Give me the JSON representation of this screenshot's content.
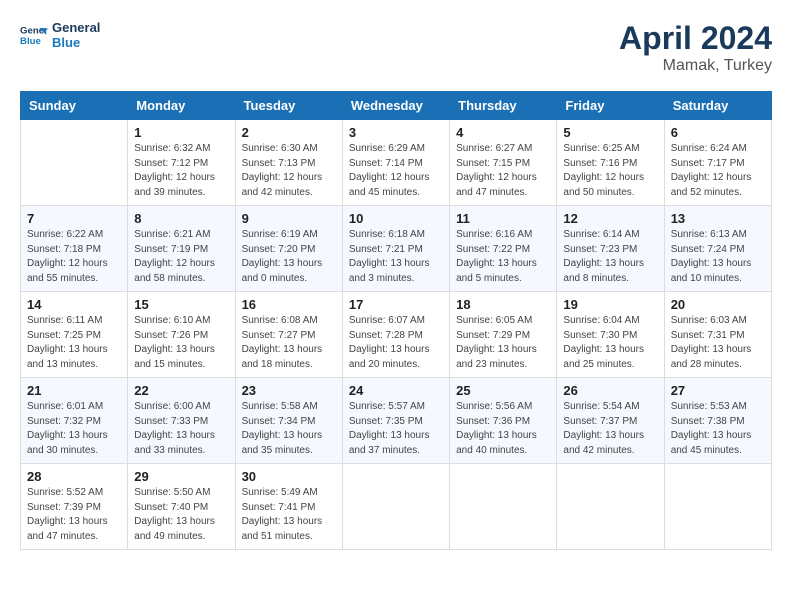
{
  "header": {
    "logo_line1": "General",
    "logo_line2": "Blue",
    "month_year": "April 2024",
    "location": "Mamak, Turkey"
  },
  "days_of_week": [
    "Sunday",
    "Monday",
    "Tuesday",
    "Wednesday",
    "Thursday",
    "Friday",
    "Saturday"
  ],
  "weeks": [
    [
      {
        "day": "",
        "info": ""
      },
      {
        "day": "1",
        "info": "Sunrise: 6:32 AM\nSunset: 7:12 PM\nDaylight: 12 hours\nand 39 minutes."
      },
      {
        "day": "2",
        "info": "Sunrise: 6:30 AM\nSunset: 7:13 PM\nDaylight: 12 hours\nand 42 minutes."
      },
      {
        "day": "3",
        "info": "Sunrise: 6:29 AM\nSunset: 7:14 PM\nDaylight: 12 hours\nand 45 minutes."
      },
      {
        "day": "4",
        "info": "Sunrise: 6:27 AM\nSunset: 7:15 PM\nDaylight: 12 hours\nand 47 minutes."
      },
      {
        "day": "5",
        "info": "Sunrise: 6:25 AM\nSunset: 7:16 PM\nDaylight: 12 hours\nand 50 minutes."
      },
      {
        "day": "6",
        "info": "Sunrise: 6:24 AM\nSunset: 7:17 PM\nDaylight: 12 hours\nand 52 minutes."
      }
    ],
    [
      {
        "day": "7",
        "info": "Sunrise: 6:22 AM\nSunset: 7:18 PM\nDaylight: 12 hours\nand 55 minutes."
      },
      {
        "day": "8",
        "info": "Sunrise: 6:21 AM\nSunset: 7:19 PM\nDaylight: 12 hours\nand 58 minutes."
      },
      {
        "day": "9",
        "info": "Sunrise: 6:19 AM\nSunset: 7:20 PM\nDaylight: 13 hours\nand 0 minutes."
      },
      {
        "day": "10",
        "info": "Sunrise: 6:18 AM\nSunset: 7:21 PM\nDaylight: 13 hours\nand 3 minutes."
      },
      {
        "day": "11",
        "info": "Sunrise: 6:16 AM\nSunset: 7:22 PM\nDaylight: 13 hours\nand 5 minutes."
      },
      {
        "day": "12",
        "info": "Sunrise: 6:14 AM\nSunset: 7:23 PM\nDaylight: 13 hours\nand 8 minutes."
      },
      {
        "day": "13",
        "info": "Sunrise: 6:13 AM\nSunset: 7:24 PM\nDaylight: 13 hours\nand 10 minutes."
      }
    ],
    [
      {
        "day": "14",
        "info": "Sunrise: 6:11 AM\nSunset: 7:25 PM\nDaylight: 13 hours\nand 13 minutes."
      },
      {
        "day": "15",
        "info": "Sunrise: 6:10 AM\nSunset: 7:26 PM\nDaylight: 13 hours\nand 15 minutes."
      },
      {
        "day": "16",
        "info": "Sunrise: 6:08 AM\nSunset: 7:27 PM\nDaylight: 13 hours\nand 18 minutes."
      },
      {
        "day": "17",
        "info": "Sunrise: 6:07 AM\nSunset: 7:28 PM\nDaylight: 13 hours\nand 20 minutes."
      },
      {
        "day": "18",
        "info": "Sunrise: 6:05 AM\nSunset: 7:29 PM\nDaylight: 13 hours\nand 23 minutes."
      },
      {
        "day": "19",
        "info": "Sunrise: 6:04 AM\nSunset: 7:30 PM\nDaylight: 13 hours\nand 25 minutes."
      },
      {
        "day": "20",
        "info": "Sunrise: 6:03 AM\nSunset: 7:31 PM\nDaylight: 13 hours\nand 28 minutes."
      }
    ],
    [
      {
        "day": "21",
        "info": "Sunrise: 6:01 AM\nSunset: 7:32 PM\nDaylight: 13 hours\nand 30 minutes."
      },
      {
        "day": "22",
        "info": "Sunrise: 6:00 AM\nSunset: 7:33 PM\nDaylight: 13 hours\nand 33 minutes."
      },
      {
        "day": "23",
        "info": "Sunrise: 5:58 AM\nSunset: 7:34 PM\nDaylight: 13 hours\nand 35 minutes."
      },
      {
        "day": "24",
        "info": "Sunrise: 5:57 AM\nSunset: 7:35 PM\nDaylight: 13 hours\nand 37 minutes."
      },
      {
        "day": "25",
        "info": "Sunrise: 5:56 AM\nSunset: 7:36 PM\nDaylight: 13 hours\nand 40 minutes."
      },
      {
        "day": "26",
        "info": "Sunrise: 5:54 AM\nSunset: 7:37 PM\nDaylight: 13 hours\nand 42 minutes."
      },
      {
        "day": "27",
        "info": "Sunrise: 5:53 AM\nSunset: 7:38 PM\nDaylight: 13 hours\nand 45 minutes."
      }
    ],
    [
      {
        "day": "28",
        "info": "Sunrise: 5:52 AM\nSunset: 7:39 PM\nDaylight: 13 hours\nand 47 minutes."
      },
      {
        "day": "29",
        "info": "Sunrise: 5:50 AM\nSunset: 7:40 PM\nDaylight: 13 hours\nand 49 minutes."
      },
      {
        "day": "30",
        "info": "Sunrise: 5:49 AM\nSunset: 7:41 PM\nDaylight: 13 hours\nand 51 minutes."
      },
      {
        "day": "",
        "info": ""
      },
      {
        "day": "",
        "info": ""
      },
      {
        "day": "",
        "info": ""
      },
      {
        "day": "",
        "info": ""
      }
    ]
  ]
}
